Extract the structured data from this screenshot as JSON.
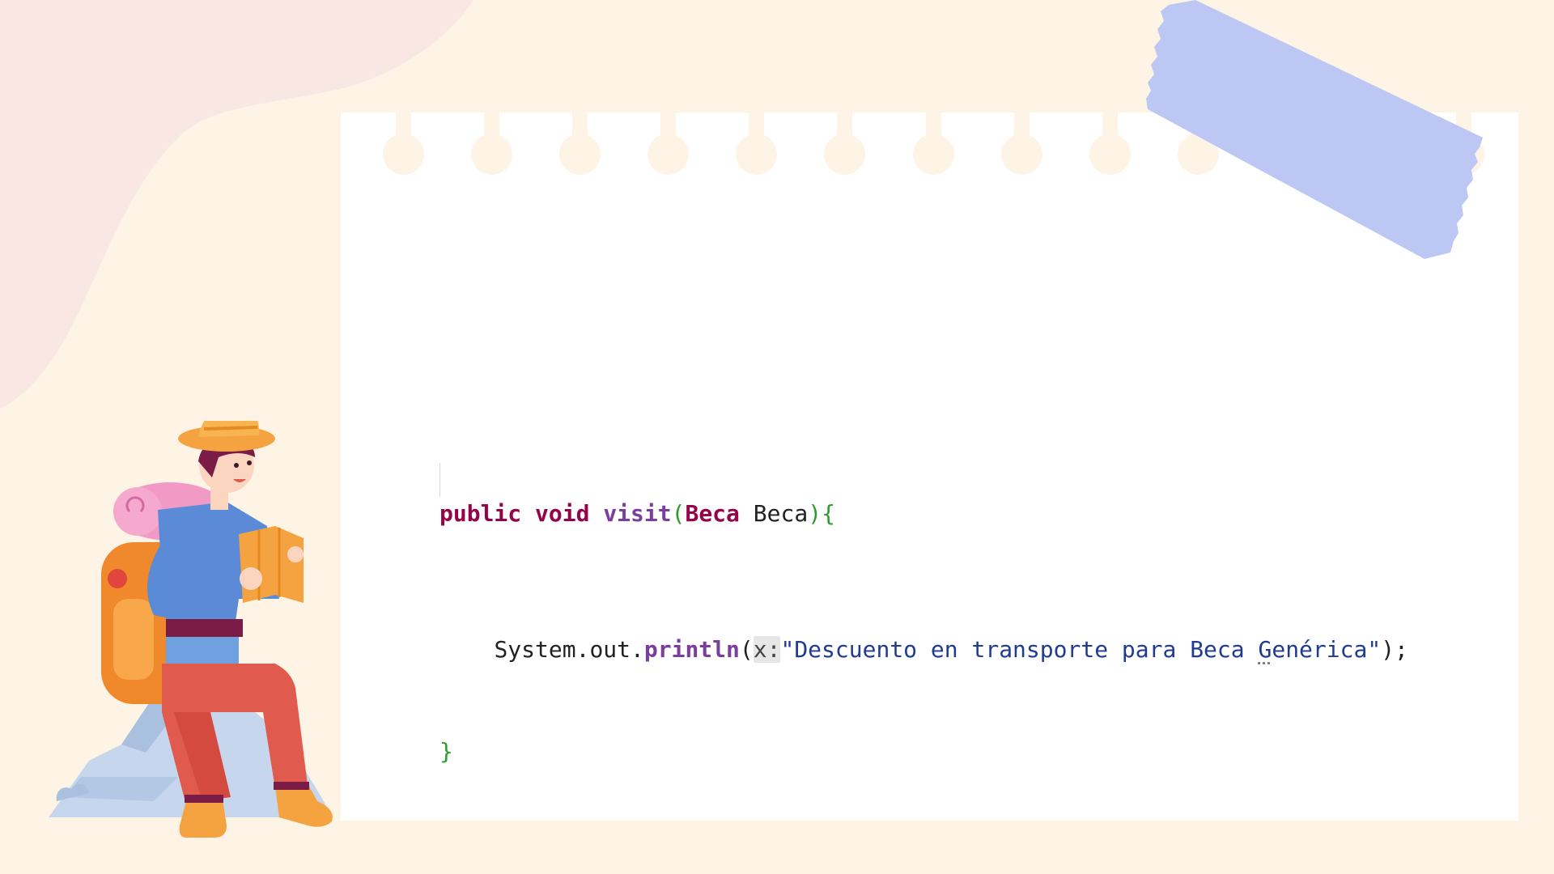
{
  "code": {
    "line1": {
      "kw_public": "public",
      "kw_void": "void",
      "method": "visit",
      "open_paren": "(",
      "type": "Beca",
      "param": "Beca",
      "close_paren": ")",
      "open_brace": "{"
    },
    "line2": {
      "indent": "    ",
      "receiver": "System.out.",
      "method": "println",
      "open_paren": "(",
      "param_hint": "x:",
      "string_part1": "\"Descuento en transporte para Beca ",
      "string_warn": "G",
      "string_part2": "enérica\"",
      "close": ");"
    },
    "line3": {
      "close_brace": "}"
    }
  },
  "colors": {
    "background": "#fdf4e5",
    "blob": "#f9e7e3",
    "paper": "#ffffff",
    "tape": "#bcc8f3",
    "keyword": "#950448",
    "method": "#7a3e9d",
    "brace": "#2f9b2f",
    "string": "#1f3c8f"
  },
  "icons": [
    "traveler-illustration",
    "washi-tape",
    "notebook-paper"
  ]
}
